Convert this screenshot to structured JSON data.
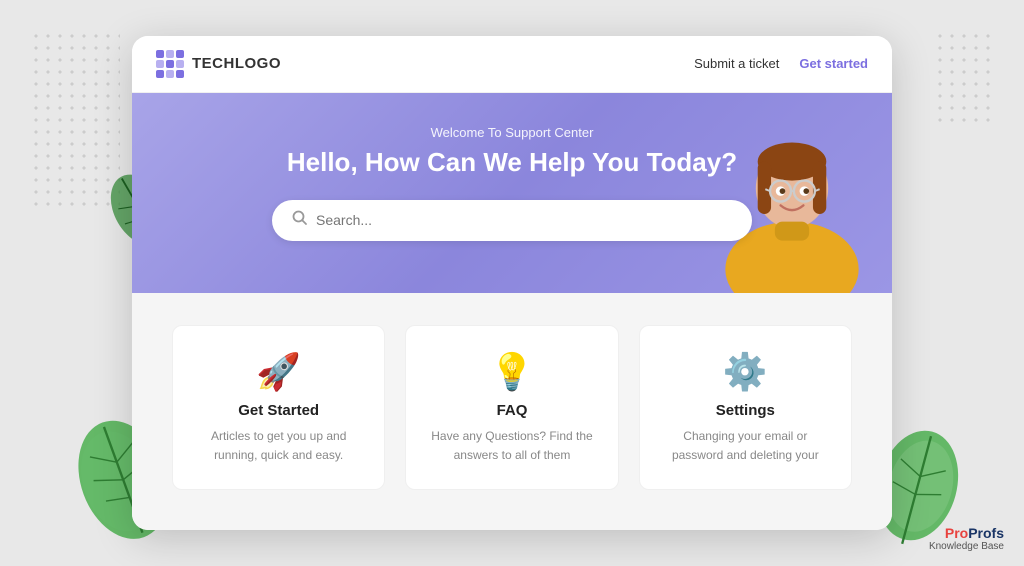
{
  "page": {
    "background_color": "#e8e8e8"
  },
  "navbar": {
    "logo_text": "TECHLOGO",
    "submit_ticket_label": "Submit a ticket",
    "get_started_label": "Get started"
  },
  "hero": {
    "subtitle": "Welcome To Support Center",
    "title": "Hello, How Can We Help You Today?",
    "search_placeholder": "Search..."
  },
  "cards": [
    {
      "icon": "🚀",
      "title": "Get Started",
      "description": "Articles to get you up and running, quick and easy.",
      "icon_name": "rocket-icon"
    },
    {
      "icon": "💡",
      "title": "FAQ",
      "description": "Have any Questions? Find the answers to all of them",
      "icon_name": "lightbulb-icon"
    },
    {
      "icon": "⚙️",
      "title": "Settings",
      "description": "Changing your email or password and deleting your",
      "icon_name": "settings-icon"
    }
  ],
  "brand": {
    "name_part1": "Pro",
    "name_part2": "Profs",
    "subtitle": "Knowledge Base"
  }
}
